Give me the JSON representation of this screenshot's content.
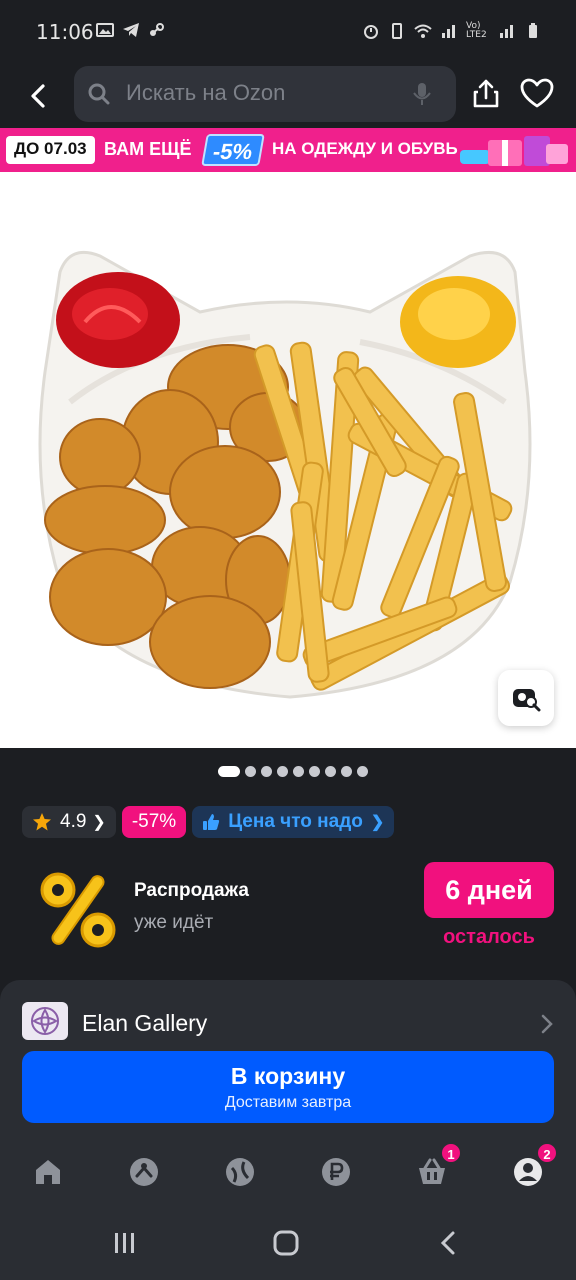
{
  "status_bar": {
    "time": "11:06",
    "network_label": "Vo) LTE2"
  },
  "search": {
    "placeholder": "Искать на Ozon"
  },
  "promo": {
    "date": "ДО 07.03",
    "text_left": "ВАМ ЕЩЁ",
    "discount": "-5%",
    "text_right": "НА ОДЕЖДУ И ОБУВЬ"
  },
  "gallery": {
    "total_images": 9,
    "active_index": 0
  },
  "chips": {
    "rating": "4.9",
    "discount": "-57%",
    "price_tag": "Цена что надо"
  },
  "sale": {
    "title": "Распродажа",
    "subtitle": "уже идёт",
    "days": "6 дней",
    "days_left": "осталось"
  },
  "seller": {
    "name": "Elan Gallery"
  },
  "cart": {
    "title": "В корзину",
    "subtitle": "Доставим завтра"
  },
  "bottom_nav": {
    "items": [
      {
        "icon": "home-icon"
      },
      {
        "icon": "catalog-icon"
      },
      {
        "icon": "fresh-icon"
      },
      {
        "icon": "wallet-icon"
      },
      {
        "icon": "cart-icon",
        "badge": "1"
      },
      {
        "icon": "profile-icon",
        "badge": "2"
      }
    ]
  },
  "colors": {
    "background": "#1c1e22",
    "accent_blue": "#005bff",
    "accent_pink": "#f1117e"
  }
}
